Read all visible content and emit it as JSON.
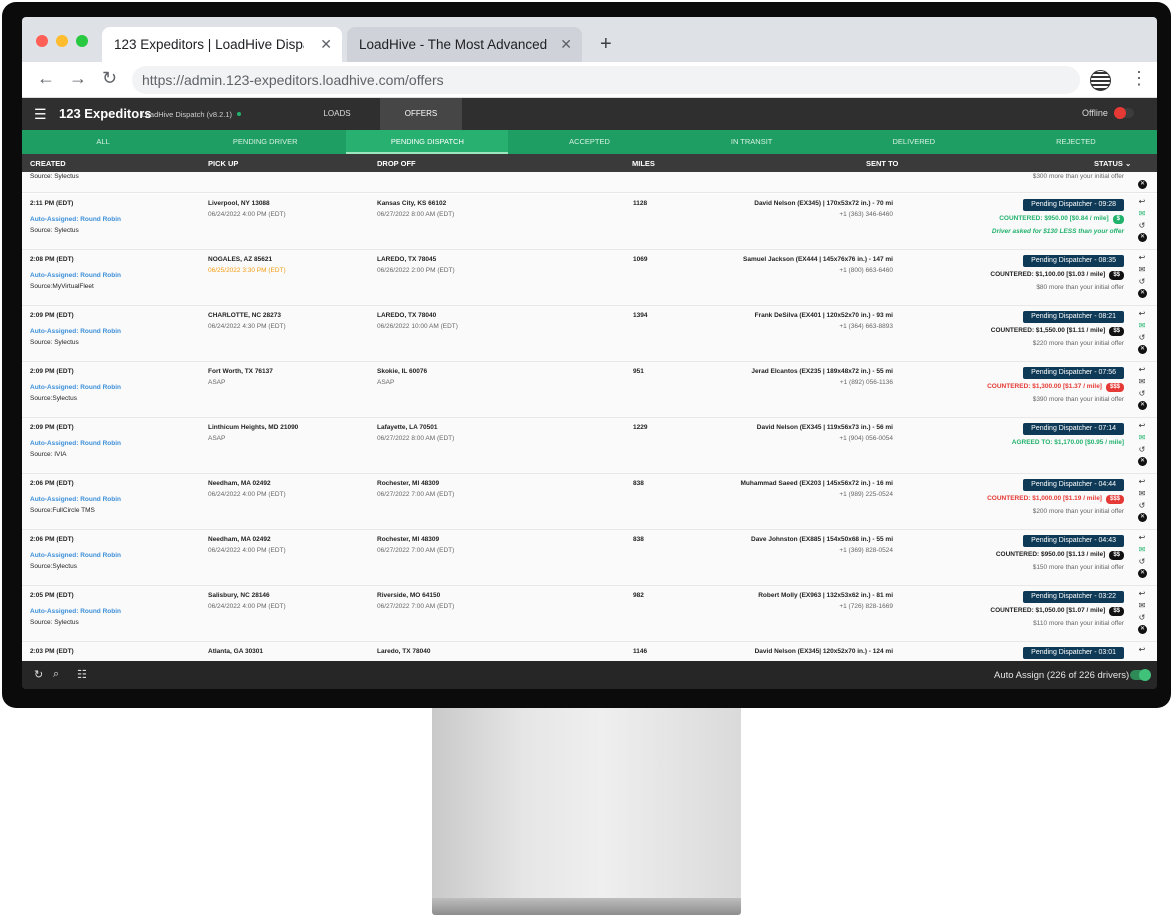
{
  "browser": {
    "tabs": [
      {
        "title": "123 Expeditors | LoadHive Dispatch"
      },
      {
        "title": "LoadHive - The Most Advanced ..."
      }
    ],
    "url": "https://admin.123-expeditors.loadhive.com/offers"
  },
  "header": {
    "brand": "123 Expeditors",
    "subtitle": "- LoadHive Dispatch (v8.2.1)",
    "nav": [
      "LOADS",
      "OFFERS"
    ],
    "offline_label": "Offline"
  },
  "status_tabs": [
    "ALL",
    "PENDING DRIVER",
    "PENDING DISPATCH",
    "ACCEPTED",
    "IN TRANSIT",
    "DELIVERED",
    "REJECTED"
  ],
  "columns": {
    "created": "CREATED",
    "pickup": "PICK UP",
    "dropoff": "DROP OFF",
    "miles": "MILES",
    "sent_to": "SENT TO",
    "status": "STATUS"
  },
  "partial_row": {
    "source": "Source: Sylectus",
    "note": "$300 more than your initial offer"
  },
  "rows": [
    {
      "created": "2:11 PM (EDT)",
      "assigned": "Auto-Assigned: Round Robin",
      "source": "Source: Sylectus",
      "pickup_city": "Liverpool, NY 13088",
      "pickup_time": "06/24/2022 4:00 PM (EDT)",
      "drop_city": "Kansas City, KS 66102",
      "drop_time": "06/27/2022 8:00 AM (EDT)",
      "miles": "1128",
      "driver": "David Nelson (EX345) | 170x53x72 in.) - 70 mi",
      "phone": "+1 (363) 346-6460",
      "pill": "Pending Dispatcher - 09:28",
      "counter": "COUNTERED: $950.00 [$0.84 / mile]",
      "badge": "$",
      "note": "Driver asked for $130 LESS than your offer"
    },
    {
      "created": "2:08 PM (EDT)",
      "assigned": "Auto-Assigned: Round Robin",
      "source": "Source:MyVirtualFleet",
      "pickup_city": "NOGALES, AZ 85621",
      "pickup_time": "06/25/2022 3:30 PM (EDT)",
      "drop_city": "LAREDO, TX 78045",
      "drop_time": "06/26/2022 2:00 PM (EDT)",
      "miles": "1069",
      "driver": "Samuel Jackson (EX444 | 145x76x76 in.) - 147 mi",
      "phone": "+1 (800) 663-6460",
      "pill": "Pending Dispatcher - 08:35",
      "counter": "COUNTERED: $1,100.00 [$1.03 / mile]",
      "badge": "$$",
      "note": "$80 more than your initial offer"
    },
    {
      "created": "2:09 PM (EDT)",
      "assigned": "Auto-Assigned: Round Robin",
      "source": "Source: Sylectus",
      "pickup_city": "CHARLOTTE, NC 28273",
      "pickup_time": "06/24/2022 4:30 PM (EDT)",
      "drop_city": "LAREDO, TX 78040",
      "drop_time": "06/26/2022 10:00 AM (EDT)",
      "miles": "1394",
      "driver": "Frank DeSilva (EX401 | 120x52x70 in.) - 93 mi",
      "phone": "+1 (364) 663-8893",
      "pill": "Pending Dispatcher - 08:21",
      "counter": "COUNTERED: $1,550.00 [$1.11 / mile]",
      "badge": "$$",
      "note": "$220 more than your initial offer"
    },
    {
      "created": "2:09 PM (EDT)",
      "assigned": "Auto-Assigned: Round Robin",
      "source": "Source:Sylectus",
      "pickup_city": "Fort Worth, TX 76137",
      "pickup_time": "ASAP",
      "drop_city": "Skokie, IL 60076",
      "drop_time": "ASAP",
      "miles": "951",
      "driver": "Jerad Elcantos (EX235 | 189x48x72 in.) - 55 mi",
      "phone": "+1 (892) 056-1136",
      "pill": "Pending Dispatcher - 07:56",
      "counter": "COUNTERED: $1,300.00 [$1.37 / mile]",
      "badge": "$$$",
      "note": "$390 more than your initial offer"
    },
    {
      "created": "2:09 PM (EDT)",
      "assigned": "Auto-Assigned: Round Robin",
      "source": "Source: IVIA",
      "pickup_city": "Linthicum Heights, MD 21090",
      "pickup_time": "ASAP",
      "drop_city": "Lafayette, LA 70501",
      "drop_time": "06/27/2022 8:00 AM (EDT)",
      "miles": "1229",
      "driver": "David Nelson (EX345 | 119x56x73 in.) - 56 mi",
      "phone": "+1 (904) 056-0054",
      "pill": "Pending Dispatcher - 07:14",
      "counter": "AGREED TO: $1,170.00 [$0.95 / mile]",
      "badge": "",
      "note": ""
    },
    {
      "created": "2:06 PM (EDT)",
      "assigned": "Auto-Assigned: Round Robin",
      "source": "Source:FullCircle TMS",
      "pickup_city": "Needham, MA 02492",
      "pickup_time": "06/24/2022 4:00 PM (EDT)",
      "drop_city": "Rochester, MI 48309",
      "drop_time": "06/27/2022 7:00 AM (EDT)",
      "miles": "838",
      "driver": "Muhammad Saeed (EX203 | 145x56x72 in.) - 16 mi",
      "phone": "+1 (989) 225-0524",
      "pill": "Pending Dispatcher - 04:44",
      "counter": "COUNTERED: $1,000.00 [$1.19 / mile]",
      "badge": "$$$",
      "note": "$200 more than your initial offer"
    },
    {
      "created": "2:06 PM (EDT)",
      "assigned": "Auto-Assigned: Round Robin",
      "source": "Source:Sylectus",
      "pickup_city": "Needham, MA 02492",
      "pickup_time": "06/24/2022 4:00 PM (EDT)",
      "drop_city": "Rochester, MI 48309",
      "drop_time": "06/27/2022 7:00 AM (EDT)",
      "miles": "838",
      "driver": "Dave Johnston (EX885 | 154x50x68 in.) - 55 mi",
      "phone": "+1 (369) 828-0524",
      "pill": "Pending Dispatcher - 04:43",
      "counter": "COUNTERED: $950.00 [$1.13 / mile]",
      "badge": "$$",
      "note": "$150 more than your initial offer"
    },
    {
      "created": "2:05 PM (EDT)",
      "assigned": "Auto-Assigned: Round Robin",
      "source": "Source: Sylectus",
      "pickup_city": "Salisbury, NC 28146",
      "pickup_time": "06/24/2022 4:00 PM (EDT)",
      "drop_city": "Riverside, MO 64150",
      "drop_time": "06/27/2022 7:00 AM (EDT)",
      "miles": "982",
      "driver": "Robert Molly (EX963 | 132x53x62 in.) - 81 mi",
      "phone": "+1 (726) 828-1669",
      "pill": "Pending Dispatcher - 03:22",
      "counter": "COUNTERED: $1,050.00 [$1.07 / mile]",
      "badge": "$$",
      "note": "$110 more than your initial offer"
    },
    {
      "created": "2:03 PM (EDT)",
      "assigned": "",
      "source": "",
      "pickup_city": "Atlanta, GA 30301",
      "pickup_time": "",
      "drop_city": "Laredo, TX 78040",
      "drop_time": "",
      "miles": "1146",
      "driver": "David Nelson (EX345| 120x52x70 in.) - 124 mi",
      "phone": "",
      "pill": "Pending Dispatcher - 03:01",
      "counter": "",
      "badge": "",
      "note": ""
    }
  ],
  "footer": {
    "auto_assign": "Auto Assign (226 of 226 drivers)"
  }
}
